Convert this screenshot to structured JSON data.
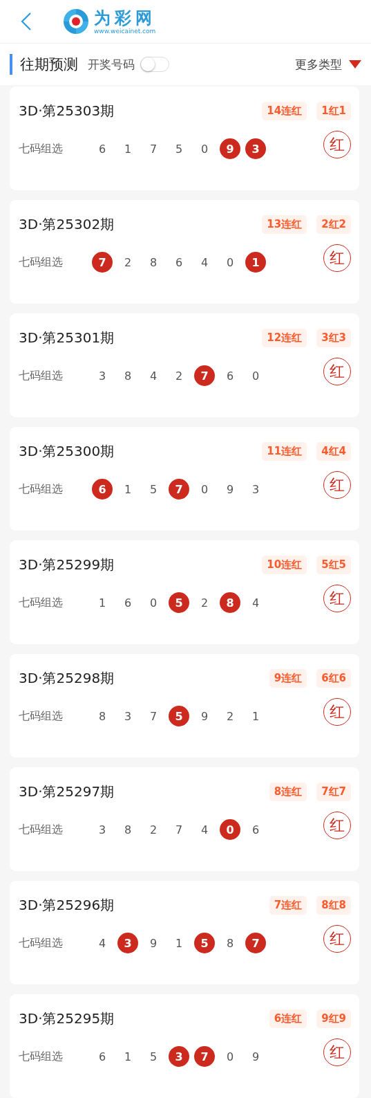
{
  "header": {
    "logo_name": "为彩网",
    "logo_url": "www.weicainet.com"
  },
  "section": {
    "title": "往期预测",
    "toggle_label": "开奖号码",
    "toggle_on": false,
    "more": "更多类型"
  },
  "cards": [
    {
      "title": "3D·第25303期",
      "streak": "14连红",
      "hit_tag": "1红1",
      "label": "七码组选",
      "result": "红",
      "numbers": [
        {
          "value": "6",
          "hit": false
        },
        {
          "value": "1",
          "hit": false
        },
        {
          "value": "7",
          "hit": false
        },
        {
          "value": "5",
          "hit": false
        },
        {
          "value": "0",
          "hit": false
        },
        {
          "value": "9",
          "hit": true
        },
        {
          "value": "3",
          "hit": true
        }
      ]
    },
    {
      "title": "3D·第25302期",
      "streak": "13连红",
      "hit_tag": "2红2",
      "label": "七码组选",
      "result": "红",
      "numbers": [
        {
          "value": "7",
          "hit": true
        },
        {
          "value": "2",
          "hit": false
        },
        {
          "value": "8",
          "hit": false
        },
        {
          "value": "6",
          "hit": false
        },
        {
          "value": "4",
          "hit": false
        },
        {
          "value": "0",
          "hit": false
        },
        {
          "value": "1",
          "hit": true
        }
      ]
    },
    {
      "title": "3D·第25301期",
      "streak": "12连红",
      "hit_tag": "3红3",
      "label": "七码组选",
      "result": "红",
      "numbers": [
        {
          "value": "3",
          "hit": false
        },
        {
          "value": "8",
          "hit": false
        },
        {
          "value": "4",
          "hit": false
        },
        {
          "value": "2",
          "hit": false
        },
        {
          "value": "7",
          "hit": true
        },
        {
          "value": "6",
          "hit": false
        },
        {
          "value": "0",
          "hit": false
        }
      ]
    },
    {
      "title": "3D·第25300期",
      "streak": "11连红",
      "hit_tag": "4红4",
      "label": "七码组选",
      "result": "红",
      "numbers": [
        {
          "value": "6",
          "hit": true
        },
        {
          "value": "1",
          "hit": false
        },
        {
          "value": "5",
          "hit": false
        },
        {
          "value": "7",
          "hit": true
        },
        {
          "value": "0",
          "hit": false
        },
        {
          "value": "9",
          "hit": false
        },
        {
          "value": "3",
          "hit": false
        }
      ]
    },
    {
      "title": "3D·第25299期",
      "streak": "10连红",
      "hit_tag": "5红5",
      "label": "七码组选",
      "result": "红",
      "numbers": [
        {
          "value": "1",
          "hit": false
        },
        {
          "value": "6",
          "hit": false
        },
        {
          "value": "0",
          "hit": false
        },
        {
          "value": "5",
          "hit": true
        },
        {
          "value": "2",
          "hit": false
        },
        {
          "value": "8",
          "hit": true
        },
        {
          "value": "4",
          "hit": false
        }
      ]
    },
    {
      "title": "3D·第25298期",
      "streak": "9连红",
      "hit_tag": "6红6",
      "label": "七码组选",
      "result": "红",
      "numbers": [
        {
          "value": "8",
          "hit": false
        },
        {
          "value": "3",
          "hit": false
        },
        {
          "value": "7",
          "hit": false
        },
        {
          "value": "5",
          "hit": true
        },
        {
          "value": "9",
          "hit": false
        },
        {
          "value": "2",
          "hit": false
        },
        {
          "value": "1",
          "hit": false
        }
      ]
    },
    {
      "title": "3D·第25297期",
      "streak": "8连红",
      "hit_tag": "7红7",
      "label": "七码组选",
      "result": "红",
      "numbers": [
        {
          "value": "3",
          "hit": false
        },
        {
          "value": "8",
          "hit": false
        },
        {
          "value": "2",
          "hit": false
        },
        {
          "value": "7",
          "hit": false
        },
        {
          "value": "4",
          "hit": false
        },
        {
          "value": "0",
          "hit": true
        },
        {
          "value": "6",
          "hit": false
        }
      ]
    },
    {
      "title": "3D·第25296期",
      "streak": "7连红",
      "hit_tag": "8红8",
      "label": "七码组选",
      "result": "红",
      "numbers": [
        {
          "value": "4",
          "hit": false
        },
        {
          "value": "3",
          "hit": true
        },
        {
          "value": "9",
          "hit": false
        },
        {
          "value": "1",
          "hit": false
        },
        {
          "value": "5",
          "hit": true
        },
        {
          "value": "8",
          "hit": false
        },
        {
          "value": "7",
          "hit": true
        }
      ]
    },
    {
      "title": "3D·第25295期",
      "streak": "6连红",
      "hit_tag": "9红9",
      "label": "七码组选",
      "result": "红",
      "numbers": [
        {
          "value": "6",
          "hit": false
        },
        {
          "value": "1",
          "hit": false
        },
        {
          "value": "5",
          "hit": false
        },
        {
          "value": "3",
          "hit": true
        },
        {
          "value": "7",
          "hit": true
        },
        {
          "value": "0",
          "hit": false
        },
        {
          "value": "9",
          "hit": false
        }
      ]
    }
  ]
}
